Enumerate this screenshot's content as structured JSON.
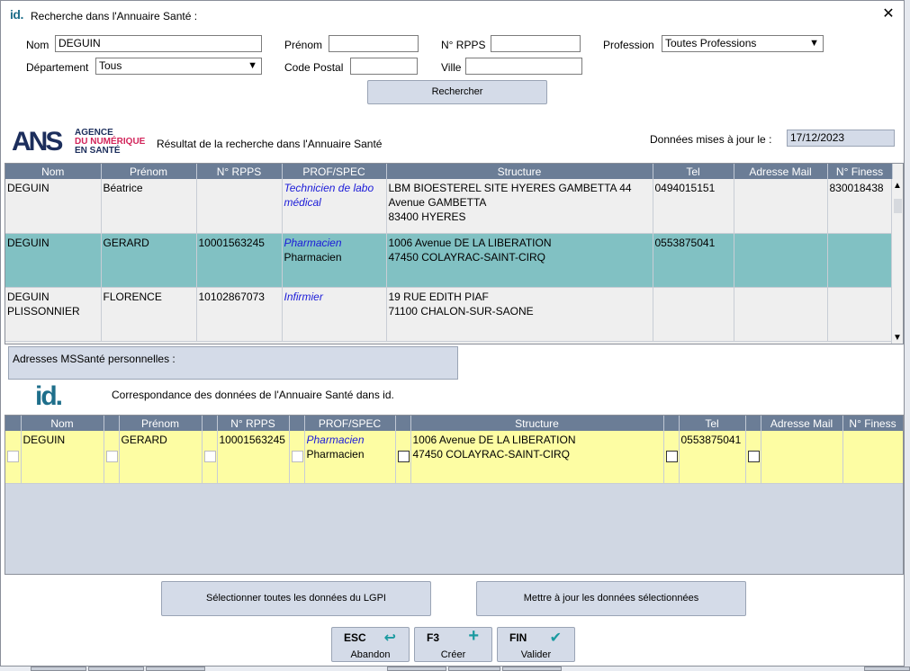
{
  "window": {
    "logo": "id.",
    "title": "Recherche dans l'Annuaire Santé :",
    "close": "✕"
  },
  "form": {
    "nom_label": "Nom",
    "nom_value": "DEGUIN",
    "prenom_label": "Prénom",
    "prenom_value": "",
    "rpps_label": "N° RPPS",
    "rpps_value": "",
    "profession_label": "Profession",
    "profession_value": "Toutes Professions",
    "departement_label": "Département",
    "departement_value": "Tous",
    "cp_label": "Code Postal",
    "cp_value": "",
    "ville_label": "Ville",
    "ville_value": "",
    "search_button": "Rechercher"
  },
  "ans_logo": {
    "letters": "ANS",
    "line1": "AGENCE",
    "line2": "DU NUMÉRIQUE",
    "line3": "EN SANTÉ"
  },
  "result_title": "Résultat de la recherche dans l'Annuaire Santé",
  "update": {
    "label": "Données mises à jour le :",
    "date": "17/12/2023"
  },
  "columns": [
    "Nom",
    "Prénom",
    "N° RPPS",
    "PROF/SPEC",
    "Structure",
    "Tel",
    "Adresse Mail",
    "N° Finess"
  ],
  "results": [
    {
      "nom": "DEGUIN",
      "prenom": "Béatrice",
      "rpps": "",
      "spec": "Technicien de labo médical",
      "prof": "",
      "structure_1": "LBM BIOESTEREL SITE HYERES GAMBETTA 44",
      "structure_2": "Avenue GAMBETTA",
      "structure_3": "83400 HYERES",
      "tel": "0494015151",
      "mail": "",
      "finess": "830018438"
    },
    {
      "nom": "DEGUIN",
      "prenom": "GERARD",
      "rpps": "10001563245",
      "spec": "Pharmacien",
      "prof": "Pharmacien",
      "structure_1": "1006 Avenue DE LA LIBERATION",
      "structure_2": "47450 COLAYRAC-SAINT-CIRQ",
      "structure_3": "",
      "tel": "0553875041",
      "mail": "",
      "finess": ""
    },
    {
      "nom": "DEGUIN PLISSONNIER",
      "prenom": "FLORENCE",
      "rpps": "10102867073",
      "spec": "Infirmier",
      "prof": "",
      "structure_1": "19 RUE EDITH PIAF",
      "structure_2": "71100 CHALON-SUR-SAONE",
      "structure_3": "",
      "tel": "",
      "mail": "",
      "finess": ""
    }
  ],
  "scroll": {
    "up": "▲",
    "down": "▼"
  },
  "mssante_label": "Adresses MSSanté personnelles :",
  "id_logo": "id.",
  "correspondance_title": "Correspondance des données de l'Annuaire Santé dans id.",
  "mapping_columns": [
    "Nom",
    "Prénom",
    "N° RPPS",
    "PROF/SPEC",
    "Structure",
    "Tel",
    "Adresse Mail",
    "N° Finess"
  ],
  "mapping": {
    "nom": "DEGUIN",
    "prenom": "GERARD",
    "rpps": "10001563245",
    "spec": "Pharmacien",
    "prof": "Pharmacien",
    "structure_1": "1006 Avenue DE LA LIBERATION",
    "structure_2": "47450 COLAYRAC-SAINT-CIRQ",
    "tel": "0553875041",
    "mail": "",
    "finess": ""
  },
  "buttons": {
    "select_all": "Sélectionner toutes les données du LGPI",
    "update_selected": "Mettre à jour les données sélectionnées"
  },
  "fkeys": [
    {
      "key": "ESC",
      "icon": "↩",
      "label": "Abandon"
    },
    {
      "key": "F3",
      "icon": "+",
      "label": "Créer"
    },
    {
      "key": "FIN",
      "icon": "✔",
      "label": "Valider"
    }
  ],
  "colors": {
    "header_bg": "#6b7d96",
    "selected_row": "#81c1c3",
    "mapping_row": "#fdfda3",
    "accent": "#1a9aa0"
  }
}
